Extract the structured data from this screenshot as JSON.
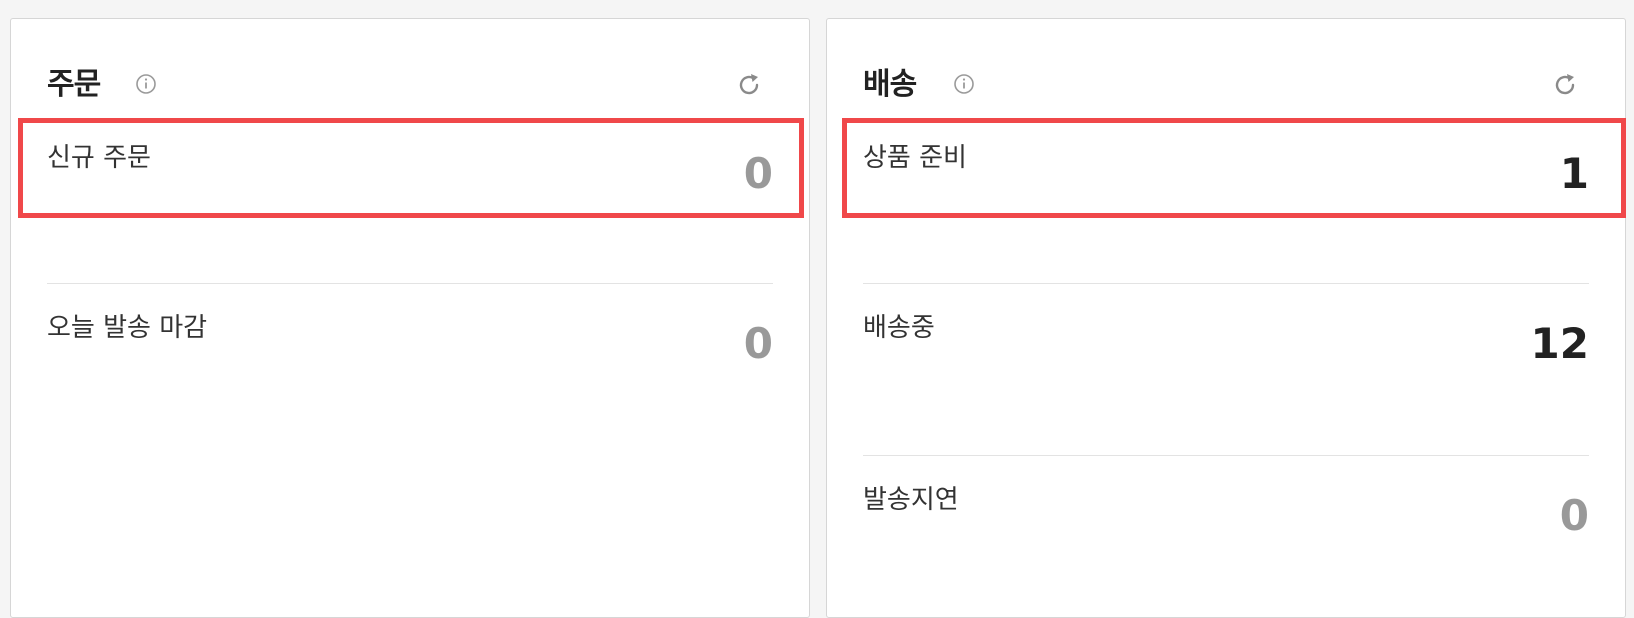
{
  "panels": {
    "orders": {
      "title": "주문",
      "rows": [
        {
          "label": "신규 주문",
          "value": "0"
        },
        {
          "label": "오늘 발송 마감",
          "value": "0"
        }
      ]
    },
    "delivery": {
      "title": "배송",
      "rows": [
        {
          "label": "상품 준비",
          "value": "1"
        },
        {
          "label": "배송중",
          "value": "12"
        },
        {
          "label": "발송지연",
          "value": "0"
        }
      ]
    }
  },
  "colors": {
    "highlight": "#f0484a",
    "zero_value": "#999999",
    "nonzero_value": "#222222"
  },
  "icons": [
    "info-icon",
    "refresh-icon"
  ]
}
